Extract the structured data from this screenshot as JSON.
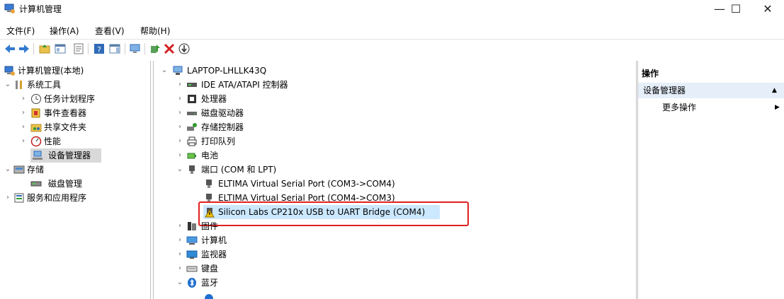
{
  "window": {
    "title": "计算机管理",
    "minimize": "—",
    "maximize": "☐",
    "close": "✕"
  },
  "menu": [
    "文件(F)",
    "操作(A)",
    "查看(V)",
    "帮助(H)"
  ],
  "left_tree": {
    "root": "计算机管理(本地)",
    "system_tools": "系统工具",
    "task_scheduler": "任务计划程序",
    "event_viewer": "事件查看器",
    "shared_folders": "共享文件夹",
    "performance": "性能",
    "device_manager": "设备管理器",
    "storage": "存储",
    "disk_management": "磁盘管理",
    "services_apps": "服务和应用程序"
  },
  "device_tree": {
    "computer": "LAPTOP-LHLLK43Q",
    "ide": "IDE ATA/ATAPI 控制器",
    "cpu": "处理器",
    "disk": "磁盘驱动器",
    "storage_ctrl": "存储控制器",
    "print_queue": "打印队列",
    "battery": "电池",
    "ports": "端口 (COM 和 LPT)",
    "port1": "ELTIMA Virtual Serial Port (COM3->COM4)",
    "port2": "ELTIMA Virtual Serial Port (COM4->COM3)",
    "port3": "Silicon Labs CP210x USB to UART Bridge (COM4)",
    "firmware": "固件",
    "computer_node": "计算机",
    "monitor": "监视器",
    "keyboard": "键盘",
    "bluetooth": "蓝牙"
  },
  "actions": {
    "header": "操作",
    "section": "设备管理器",
    "more": "更多操作"
  },
  "colors": {
    "selection_blue": "#cce8ff",
    "selection_gray": "#d9d9d9",
    "highlight_red": "#e02020",
    "actions_section_bg": "#e5eef9"
  }
}
